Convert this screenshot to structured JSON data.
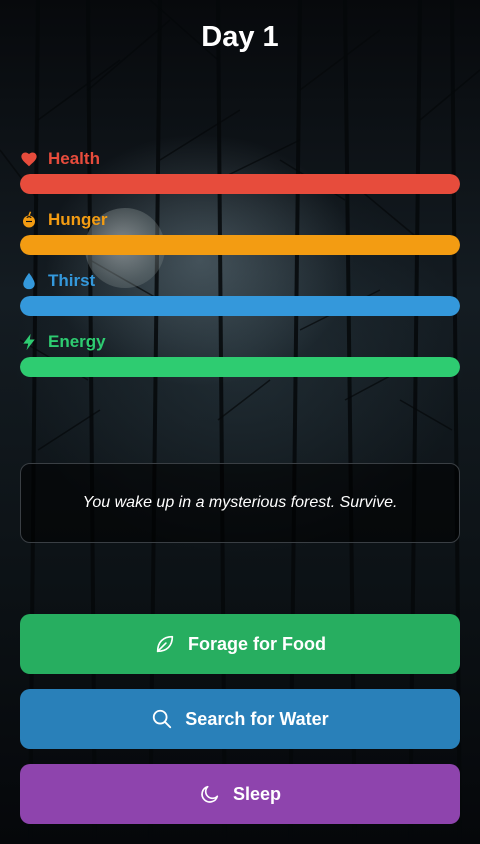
{
  "day_title": "Day 1",
  "stats": [
    {
      "id": "health",
      "label": "Health",
      "icon": "heart-icon",
      "color": "#e74c3c",
      "level": 1.0
    },
    {
      "id": "hunger",
      "label": "Hunger",
      "icon": "food-icon",
      "color": "#f39c12",
      "level": 1.0
    },
    {
      "id": "thirst",
      "label": "Thirst",
      "icon": "water-drop-icon",
      "color": "#3498db",
      "level": 1.0
    },
    {
      "id": "energy",
      "label": "Energy",
      "icon": "lightning-icon",
      "color": "#2ecc71",
      "level": 1.0
    }
  ],
  "message": "You wake up in a mysterious forest. Survive.",
  "actions": [
    {
      "id": "forage",
      "label": "Forage for Food",
      "icon": "leaf-icon",
      "color": "#27ae60"
    },
    {
      "id": "water",
      "label": "Search for Water",
      "icon": "search-icon",
      "color": "#2980b9"
    },
    {
      "id": "sleep",
      "label": "Sleep",
      "icon": "moon-icon",
      "color": "#8e44ad"
    }
  ]
}
